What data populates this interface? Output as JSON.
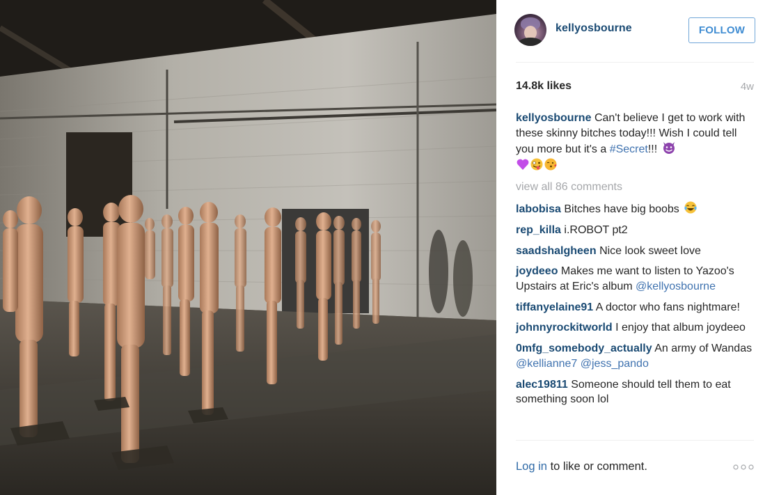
{
  "post": {
    "username": "kellyosbourne",
    "follow_label": "FOLLOW",
    "likes": "14.8k likes",
    "time": "4w",
    "caption": {
      "user": "kellyosbourne",
      "text_part1": "Can't believe I get to work with these skinny bitches today!!! Wish I could tell you more but it's a",
      "hashtag": "#Secret",
      "text_part2": "!!!"
    },
    "view_all_comments": "view all 86 comments",
    "comments": [
      {
        "user": "labobisa",
        "text": "Bitches have big boobs"
      },
      {
        "user": "rep_killa",
        "text": "i.ROBOT pt2"
      },
      {
        "user": "saadshalgheen",
        "text": "Nice look sweet love"
      },
      {
        "user": "joydeeo",
        "text": "Makes me want to listen to Yazoo's Upstairs at Eric's album",
        "mention": "@kellyosbourne"
      },
      {
        "user": "tiffanyelaine91",
        "text": "A doctor who fans nightmare!"
      },
      {
        "user": "johnnyrockitworld",
        "text": "I enjoy that album joydeeo"
      },
      {
        "user": "0mfg_somebody_actually",
        "text": "An army of Wandas",
        "mention": "@kellianne7",
        "mention2": "@jess_pando"
      },
      {
        "user": "alec19811",
        "text": "Someone should tell them to eat something soon lol"
      }
    ],
    "login_link": "Log in",
    "login_rest": "to like or comment.",
    "icons": {
      "caption_emoji_1": "smiling-devil-emoji",
      "caption_emoji_2": "purple-heart-emoji",
      "caption_emoji_3": "zany-face-emoji",
      "caption_emoji_4": "kissing-face-emoji",
      "comment_emoji": "laughing-tears-emoji",
      "more": "more-options-icon"
    }
  },
  "colors": {
    "username": "#1a4a73",
    "link": "#3f72af",
    "follow_border": "#70a6d8",
    "muted": "#a5a7aa"
  }
}
